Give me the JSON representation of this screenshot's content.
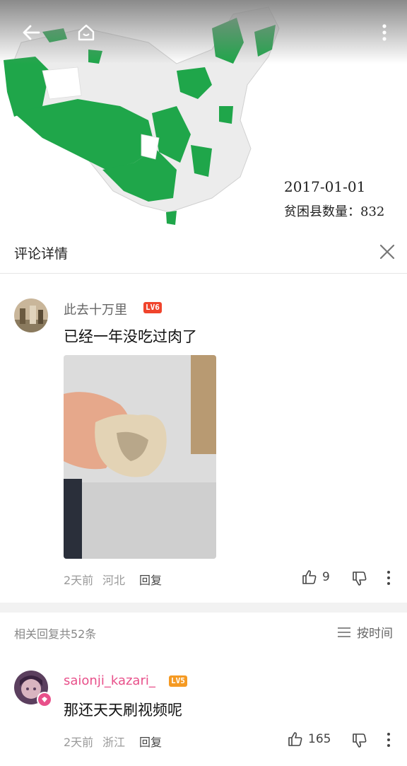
{
  "map": {
    "date": "2017-01-01",
    "count_label": "贫困县数量：832",
    "highlight_color": "#1fa64a"
  },
  "panel": {
    "title": "评论详情"
  },
  "comment": {
    "username": "此去十万里",
    "level": "LV6",
    "text": "已经一年没吃过肉了",
    "time": "2天前",
    "location": "河北",
    "reply_label": "回复",
    "likes": "9"
  },
  "replies_header": {
    "count_text": "相关回复共52条",
    "sort_label": "按时间"
  },
  "reply": {
    "username": "saionji_kazari_",
    "level": "LV5",
    "text": "那还天天刷视频呢",
    "time": "2天前",
    "location": "浙江",
    "reply_label": "回复",
    "likes": "165"
  },
  "colors": {
    "accent_pink": "#e8508a",
    "level_red": "#f0442c",
    "level_orange": "#f59a23"
  }
}
